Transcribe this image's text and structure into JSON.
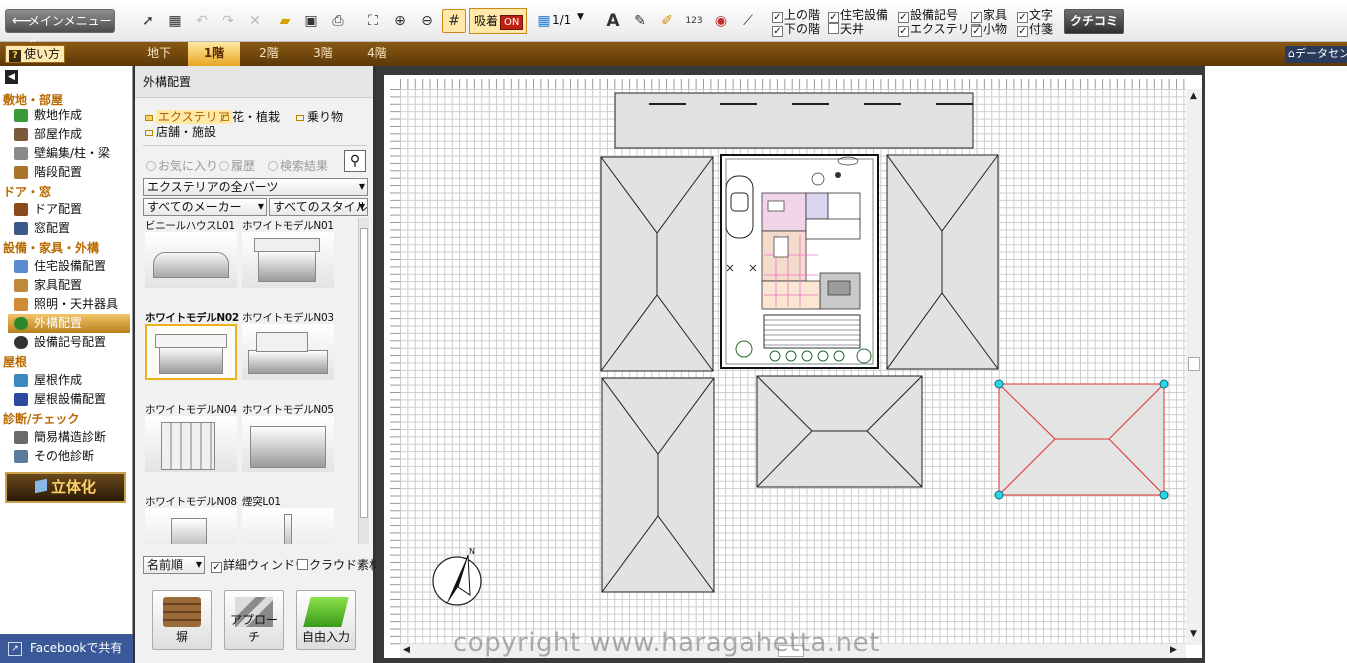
{
  "toolbar": {
    "main_menu_label": "メインメニューへ",
    "magnet_label": "吸着",
    "magnet_state": "ON",
    "page_indicator": "1/1",
    "checkboxes": [
      {
        "label": "上の階",
        "checked": true
      },
      {
        "label": "下の階",
        "checked": true
      },
      {
        "label": "住宅設備",
        "checked": true
      },
      {
        "label": "天井",
        "checked": false
      },
      {
        "label": "設備記号",
        "checked": true
      },
      {
        "label": "エクステリア",
        "checked": true
      },
      {
        "label": "家具",
        "checked": true
      },
      {
        "label": "小物",
        "checked": true
      },
      {
        "label": "文字",
        "checked": true
      },
      {
        "label": "付箋",
        "checked": true
      }
    ],
    "kuchikomi_label": "クチコミ",
    "icons": [
      "select-arrow-icon",
      "multi-select-icon",
      "undo-icon",
      "redo-icon",
      "delete-icon",
      "open-folder-icon",
      "save-icon",
      "print-icon",
      "fit-view-icon",
      "zoom-in-icon",
      "zoom-out-icon",
      "grid-icon",
      "text-icon",
      "pen-icon",
      "highlighter-icon",
      "dimension-icon",
      "compass-icon",
      "ruler-icon"
    ]
  },
  "bar2": {
    "help_label": "使い方",
    "floors": [
      "地下",
      "1階",
      "2階",
      "3階",
      "4階"
    ],
    "active_floor": "1階",
    "datacenter_label": "データセンタ"
  },
  "sidebar": {
    "sections": [
      {
        "title": "敷地・部屋",
        "items": [
          "敷地作成",
          "部屋作成",
          "壁編集/柱・梁",
          "階段配置"
        ]
      },
      {
        "title": "ドア・窓",
        "items": [
          "ドア配置",
          "窓配置"
        ]
      },
      {
        "title": "設備・家具・外構",
        "items": [
          "住宅設備配置",
          "家具配置",
          "照明・天井器具",
          "外構配置",
          "設備記号配置"
        ]
      },
      {
        "title": "屋根",
        "items": [
          "屋根作成",
          "屋根設備配置"
        ]
      },
      {
        "title": "診断/チェック",
        "items": [
          "簡易構造診断",
          "その他診断"
        ]
      }
    ],
    "active_item": "外構配置",
    "rittaika_label": "立体化",
    "facebook_label": "Facebookで共有"
  },
  "panel": {
    "title": "外構配置",
    "folders": [
      "エクステリア",
      "花・植栽",
      "乗り物",
      "店舗・施設"
    ],
    "active_folder": "エクステリア",
    "filters": [
      "お気に入り",
      "履歴",
      "検索結果"
    ],
    "category_select": "エクステリアの全パーツ",
    "maker_select": "すべてのメーカー",
    "style_select": "すべてのスタイル",
    "parts": [
      "ビニールハウスL01",
      "ホワイトモデルN01",
      "ホワイトモデルN02",
      "ホワイトモデルN03",
      "ホワイトモデルN04",
      "ホワイトモデルN05",
      "ホワイトモデルN08",
      "煙突L01"
    ],
    "selected_part": "ホワイトモデルN02",
    "sort_select": "名前順",
    "detail_window_label": "詳細ウィンドウ",
    "detail_window_checked": true,
    "cloud_label": "クラウド素材",
    "cloud_checked": false,
    "big_buttons": [
      "塀",
      "アプローチ",
      "自由入力"
    ]
  },
  "canvas": {
    "compass_label": "N",
    "watermark": "copyright www.haragahetta.net"
  },
  "colors": {
    "accent": "#e8a624",
    "brown_bar": "#6e4608",
    "facebook": "#3b5998",
    "selection": "#e03030",
    "handle": "#29d6e6"
  }
}
